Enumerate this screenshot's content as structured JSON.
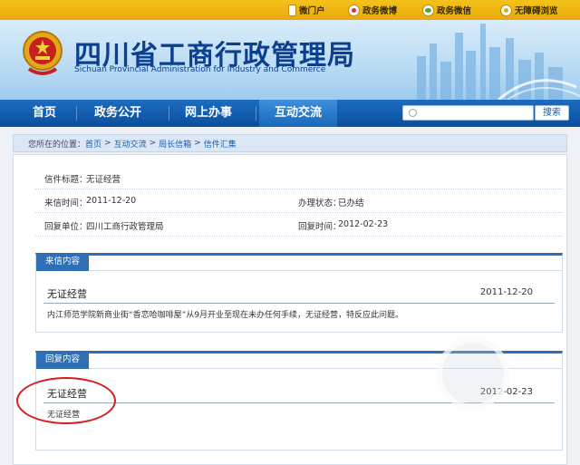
{
  "topbar": {
    "items": [
      {
        "label": "微门户",
        "icon": "phone-icon"
      },
      {
        "label": "政务微博",
        "icon": "weibo-icon"
      },
      {
        "label": "政务微信",
        "icon": "wechat-icon"
      },
      {
        "label": "无障碍浏览",
        "icon": "accessibility-icon"
      }
    ]
  },
  "header": {
    "title": "四川省工商行政管理局",
    "subtitle": "Sichuan Provincial Administration for Industry and Commerce"
  },
  "nav": {
    "items": [
      "首页",
      "政务公开",
      "网上办事",
      "互动交流"
    ],
    "active": "互动交流",
    "search_placeholder": "",
    "search_button": "搜索"
  },
  "breadcrumb": {
    "prefix": "您所在的位置：",
    "items": [
      "首页",
      "互动交流",
      "局长信箱",
      "信件汇集"
    ],
    "separator": ">"
  },
  "letter_info": {
    "subject_label": "信件标题：",
    "subject": "无证经营",
    "sent_label": "来信时间：",
    "sent": "2011-12-20",
    "status_label": "办理状态：",
    "status": "已办结",
    "reply_unit_label": "回复单位：",
    "reply_unit": "四川工商行政管理局",
    "reply_time_label": "回复时间：",
    "reply_time": "2012-02-23"
  },
  "incoming": {
    "header": "来信内容",
    "title": "无证经营",
    "date": "2011-12-20",
    "body": "内江师范学院新商业街“香恋哈咖啡屋”从9月开业至现在未办任何手续，无证经营，特反应此问题。"
  },
  "reply": {
    "header": "回复内容",
    "title": "无证经营",
    "date": "2012-02-23",
    "body": "无证经营"
  },
  "colors": {
    "topbar": "#f2bb18",
    "nav": "#0f5aa8",
    "title": "#0c3f8f",
    "annotation": "#d81e1e"
  }
}
